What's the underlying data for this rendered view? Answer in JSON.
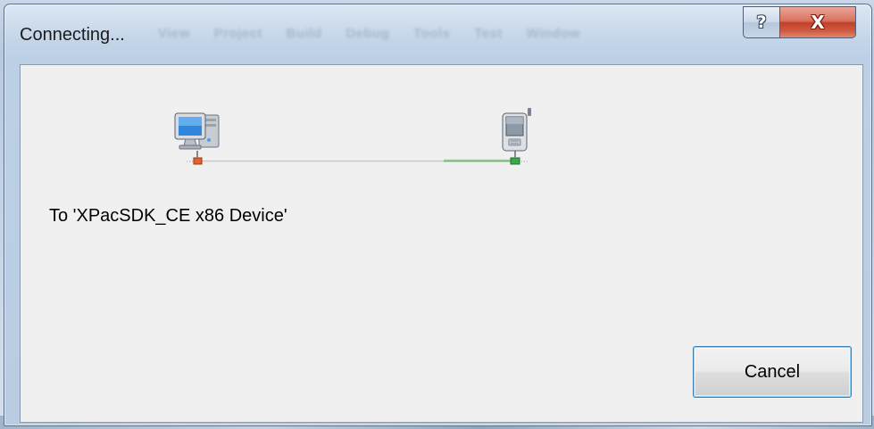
{
  "window": {
    "title": "Connecting...",
    "background_menu": [
      "View",
      "Project",
      "Build",
      "Debug",
      "Tools",
      "Test",
      "Window"
    ],
    "help_button_glyph": "?",
    "close_button_glyph": "X"
  },
  "dialog": {
    "message": "To 'XPacSDK_CE x86 Device'",
    "cancel_label": "Cancel"
  },
  "icons": {
    "source": "desktop-computer-icon",
    "target": "pocket-pc-device-icon"
  },
  "colors": {
    "client_background": "#f0f0f0",
    "close_button": "#c2402a",
    "source_port": "#e8602c",
    "target_port": "#3aa84a",
    "link_active": "#7ab87a",
    "link_idle": "#d8d8d8",
    "focus_border": "#3c7fb1"
  }
}
